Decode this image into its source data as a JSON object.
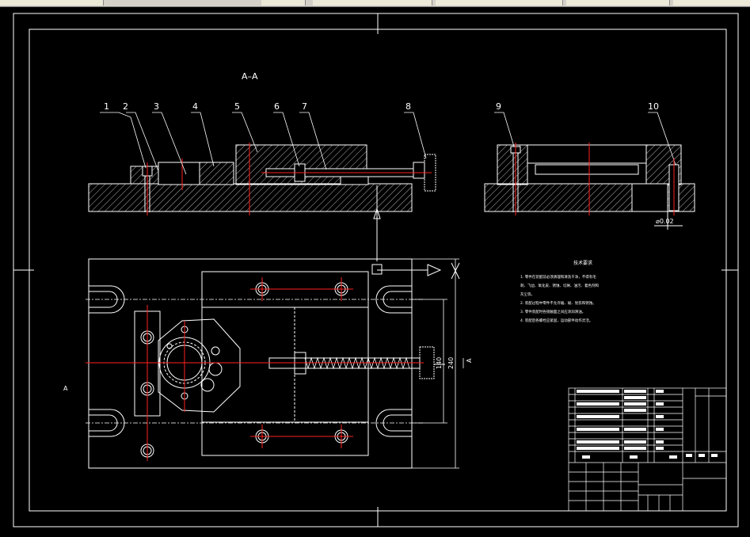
{
  "view_title": "A–A",
  "section_marker": "A",
  "part_numbers": [
    "1",
    "2",
    "3",
    "4",
    "5",
    "6",
    "7",
    "8",
    "9",
    "10"
  ],
  "dimensions": {
    "d1": "140",
    "d2": "240",
    "roughness": "⌀0.02"
  },
  "tech_requirements": {
    "title": "技术要求",
    "lines": [
      "1. 零件在装配前必须清理和清洗干净，不得有毛",
      "刺、飞边、氧化皮、锈蚀、切屑、油污、着色剂和",
      "灰尘等。",
      "2. 装配过程中零件不允许磕、碰、划伤和锈蚀。",
      "3. 零件装配时各接触面之间应涂润滑油。",
      "4. 装配后各螺栓应紧固，运动部件动作灵活。"
    ]
  },
  "colors": {
    "line": "#ffffff",
    "center": "#ff2020",
    "cyan": "#00d8ff",
    "background": "#000000"
  }
}
